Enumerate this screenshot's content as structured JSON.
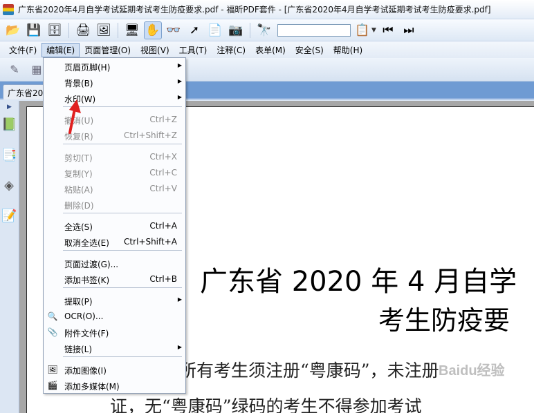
{
  "titlebar": {
    "title": "广东省2020年4月自学考试延期考试考生防疫要求.pdf - 福昕PDF套件 - [广东省2020年4月自学考试延期考试考生防疫要求.pdf]"
  },
  "toolbar": {
    "icons": [
      "open-folder-icon",
      "save-icon",
      "save-all-icon",
      "print-icon",
      "scan-icon",
      "monitor-icon",
      "hand-tool-icon",
      "zoom-glasses-icon",
      "select-arrow-icon",
      "text-select-icon",
      "camera-icon",
      "binoculars-icon",
      "search-options-icon",
      "prev-arrow-icon",
      "next-arrow-icon"
    ],
    "search_value": ""
  },
  "menubar": {
    "items": [
      "文件(F)",
      "编辑(E)",
      "页面管理(O)",
      "视图(V)",
      "工具(T)",
      "注释(C)",
      "表单(M)",
      "安全(S)",
      "帮助(H)"
    ]
  },
  "tab": {
    "label": "广东省2020"
  },
  "edit_menu": {
    "items": [
      {
        "label": "页眉页脚(H)",
        "shortcut": "",
        "submenu": true,
        "disabled": false
      },
      {
        "label": "背景(B)",
        "shortcut": "",
        "submenu": true,
        "disabled": false
      },
      {
        "label": "水印(W)",
        "shortcut": "",
        "submenu": true,
        "disabled": false
      },
      {
        "label": "撤消(U)",
        "shortcut": "Ctrl+Z",
        "submenu": false,
        "disabled": true
      },
      {
        "label": "恢复(R)",
        "shortcut": "Ctrl+Shift+Z",
        "submenu": false,
        "disabled": true
      },
      {
        "label": "剪切(T)",
        "shortcut": "Ctrl+X",
        "submenu": false,
        "disabled": true
      },
      {
        "label": "复制(Y)",
        "shortcut": "Ctrl+C",
        "submenu": false,
        "disabled": true
      },
      {
        "label": "粘贴(A)",
        "shortcut": "Ctrl+V",
        "submenu": false,
        "disabled": true
      },
      {
        "label": "删除(D)",
        "shortcut": "",
        "submenu": false,
        "disabled": true
      },
      {
        "label": "全选(S)",
        "shortcut": "Ctrl+A",
        "submenu": false,
        "disabled": false
      },
      {
        "label": "取消全选(E)",
        "shortcut": "Ctrl+Shift+A",
        "submenu": false,
        "disabled": false
      },
      {
        "label": "页面过渡(G)...",
        "shortcut": "",
        "submenu": false,
        "disabled": false
      },
      {
        "label": "添加书签(K)",
        "shortcut": "Ctrl+B",
        "submenu": false,
        "disabled": false
      },
      {
        "label": "提取(P)",
        "shortcut": "",
        "submenu": true,
        "disabled": false
      },
      {
        "label": "OCR(O)...",
        "shortcut": "",
        "submenu": false,
        "disabled": false
      },
      {
        "label": "附件文件(F)",
        "shortcut": "",
        "submenu": false,
        "disabled": false
      },
      {
        "label": "链接(L)",
        "shortcut": "",
        "submenu": true,
        "disabled": false
      },
      {
        "label": "添加图像(I)",
        "shortcut": "",
        "submenu": false,
        "disabled": false
      },
      {
        "label": "添加多媒体(M)",
        "shortcut": "",
        "submenu": false,
        "disabled": false
      }
    ]
  },
  "document": {
    "title_line1": "广东省 2020 年 4 月自学",
    "title_line2": "考生防疫要",
    "body_line1": "所有考生须注册“粤康码”，未注册",
    "body_line2": "证，无“粤康码”绿码的考生不得参加考试",
    "watermark": "Baidu经验"
  },
  "colors": {
    "accent": "#6f9bd3",
    "annotation_red": "#e02020"
  }
}
